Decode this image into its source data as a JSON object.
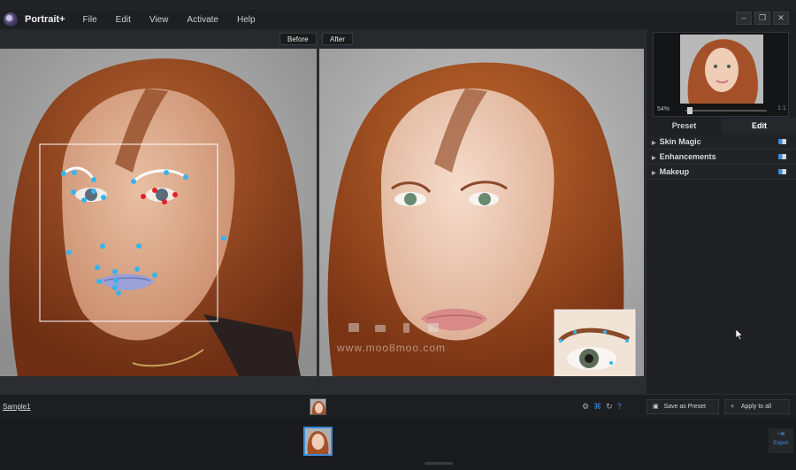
{
  "app": {
    "name": "Portrait+"
  },
  "menu": [
    "File",
    "Edit",
    "View",
    "Activate",
    "Help"
  ],
  "window_controls": {
    "minimize": "–",
    "restore": "❐",
    "close": "✕"
  },
  "compare": {
    "before_label": "Before",
    "after_label": "After",
    "watermark": "www.moo8moo.com"
  },
  "navigator": {
    "zoom": "54%",
    "fit": "1:1"
  },
  "tabs": {
    "preset": "Preset",
    "edit": "Edit"
  },
  "sections": [
    "Skin Magic",
    "Enhancements",
    "Makeup"
  ],
  "bottom": {
    "file_name": "Sample1",
    "save_preset": "Save as Preset",
    "apply_all": "Apply to all",
    "help": "?"
  },
  "export": {
    "label": "Export"
  },
  "colors": {
    "accent": "#3b8bd9",
    "landmark": "#35b5f0",
    "landmark_active": "#e0222b",
    "face_box": "#ffffff"
  }
}
